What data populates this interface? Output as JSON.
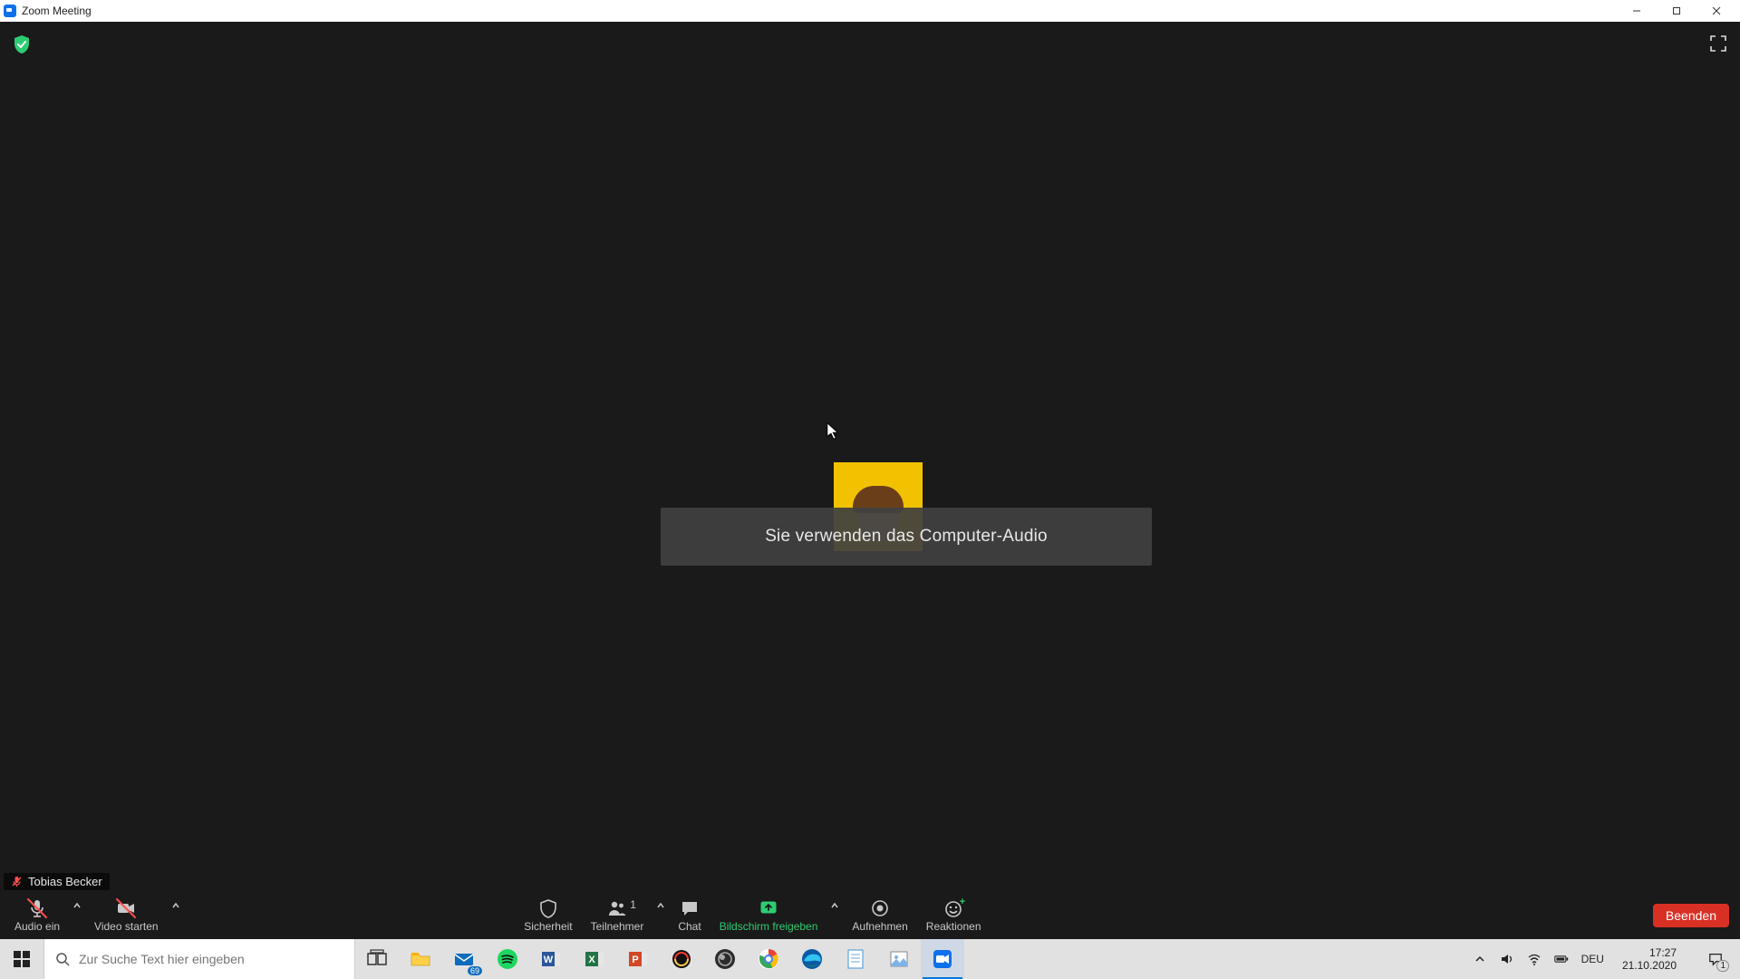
{
  "window": {
    "title": "Zoom Meeting"
  },
  "meeting": {
    "toast_text": "Sie verwenden das Computer-Audio",
    "self_name": "Tobias Becker",
    "participant_count": "1"
  },
  "controls": {
    "audio_label": "Audio ein",
    "video_label": "Video starten",
    "security_label": "Sicherheit",
    "participants_label": "Teilnehmer",
    "chat_label": "Chat",
    "share_label": "Bildschirm freigeben",
    "record_label": "Aufnehmen",
    "reactions_label": "Reaktionen",
    "end_label": "Beenden"
  },
  "taskbar": {
    "search_placeholder": "Zur Suche Text hier eingeben",
    "language": "DEU",
    "time": "17:27",
    "date": "21.10.2020",
    "notif_count": "1",
    "mail_badge": "69"
  }
}
